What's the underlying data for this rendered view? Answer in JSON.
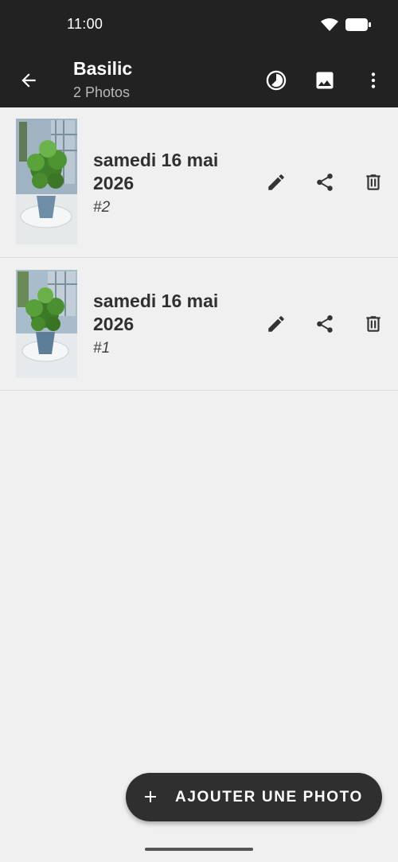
{
  "status_bar": {
    "time": "11:00",
    "icons": [
      "wifi-icon",
      "battery-icon"
    ]
  },
  "app_bar": {
    "title": "Basilic",
    "subtitle": "2 Photos",
    "icons": [
      "back-arrow-icon",
      "timelapse-icon",
      "image-icon",
      "more-vert-icon"
    ]
  },
  "photos": [
    {
      "date": "samedi 16 mai 2026",
      "number": "#2",
      "actions": [
        "edit-icon",
        "share-icon",
        "delete-icon"
      ]
    },
    {
      "date": "samedi 16 mai 2026",
      "number": "#1",
      "actions": [
        "edit-icon",
        "share-icon",
        "delete-icon"
      ]
    }
  ],
  "fab": {
    "label": "AJOUTER UNE PHOTO",
    "icon": "plus-icon"
  },
  "colors": {
    "app_bar_bg": "#222222",
    "list_bg": "#f0f0f0",
    "fab_bg": "#2f2f2f",
    "icon_dark": "#333333"
  }
}
